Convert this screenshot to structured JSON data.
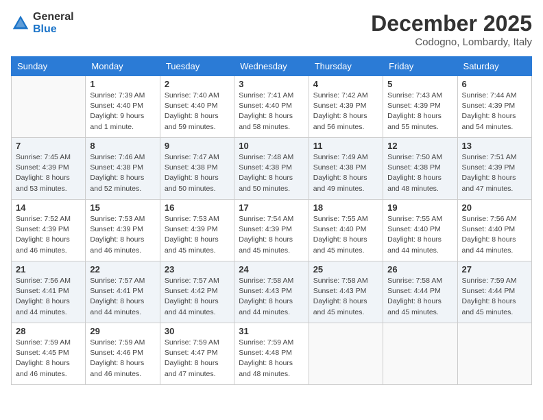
{
  "logo": {
    "general": "General",
    "blue": "Blue"
  },
  "header": {
    "month": "December 2025",
    "location": "Codogno, Lombardy, Italy"
  },
  "weekdays": [
    "Sunday",
    "Monday",
    "Tuesday",
    "Wednesday",
    "Thursday",
    "Friday",
    "Saturday"
  ],
  "weeks": [
    [
      {
        "day": "",
        "info": ""
      },
      {
        "day": "1",
        "info": "Sunrise: 7:39 AM\nSunset: 4:40 PM\nDaylight: 9 hours\nand 1 minute."
      },
      {
        "day": "2",
        "info": "Sunrise: 7:40 AM\nSunset: 4:40 PM\nDaylight: 8 hours\nand 59 minutes."
      },
      {
        "day": "3",
        "info": "Sunrise: 7:41 AM\nSunset: 4:40 PM\nDaylight: 8 hours\nand 58 minutes."
      },
      {
        "day": "4",
        "info": "Sunrise: 7:42 AM\nSunset: 4:39 PM\nDaylight: 8 hours\nand 56 minutes."
      },
      {
        "day": "5",
        "info": "Sunrise: 7:43 AM\nSunset: 4:39 PM\nDaylight: 8 hours\nand 55 minutes."
      },
      {
        "day": "6",
        "info": "Sunrise: 7:44 AM\nSunset: 4:39 PM\nDaylight: 8 hours\nand 54 minutes."
      }
    ],
    [
      {
        "day": "7",
        "info": "Sunrise: 7:45 AM\nSunset: 4:39 PM\nDaylight: 8 hours\nand 53 minutes."
      },
      {
        "day": "8",
        "info": "Sunrise: 7:46 AM\nSunset: 4:38 PM\nDaylight: 8 hours\nand 52 minutes."
      },
      {
        "day": "9",
        "info": "Sunrise: 7:47 AM\nSunset: 4:38 PM\nDaylight: 8 hours\nand 50 minutes."
      },
      {
        "day": "10",
        "info": "Sunrise: 7:48 AM\nSunset: 4:38 PM\nDaylight: 8 hours\nand 50 minutes."
      },
      {
        "day": "11",
        "info": "Sunrise: 7:49 AM\nSunset: 4:38 PM\nDaylight: 8 hours\nand 49 minutes."
      },
      {
        "day": "12",
        "info": "Sunrise: 7:50 AM\nSunset: 4:38 PM\nDaylight: 8 hours\nand 48 minutes."
      },
      {
        "day": "13",
        "info": "Sunrise: 7:51 AM\nSunset: 4:39 PM\nDaylight: 8 hours\nand 47 minutes."
      }
    ],
    [
      {
        "day": "14",
        "info": "Sunrise: 7:52 AM\nSunset: 4:39 PM\nDaylight: 8 hours\nand 46 minutes."
      },
      {
        "day": "15",
        "info": "Sunrise: 7:53 AM\nSunset: 4:39 PM\nDaylight: 8 hours\nand 46 minutes."
      },
      {
        "day": "16",
        "info": "Sunrise: 7:53 AM\nSunset: 4:39 PM\nDaylight: 8 hours\nand 45 minutes."
      },
      {
        "day": "17",
        "info": "Sunrise: 7:54 AM\nSunset: 4:39 PM\nDaylight: 8 hours\nand 45 minutes."
      },
      {
        "day": "18",
        "info": "Sunrise: 7:55 AM\nSunset: 4:40 PM\nDaylight: 8 hours\nand 45 minutes."
      },
      {
        "day": "19",
        "info": "Sunrise: 7:55 AM\nSunset: 4:40 PM\nDaylight: 8 hours\nand 44 minutes."
      },
      {
        "day": "20",
        "info": "Sunrise: 7:56 AM\nSunset: 4:40 PM\nDaylight: 8 hours\nand 44 minutes."
      }
    ],
    [
      {
        "day": "21",
        "info": "Sunrise: 7:56 AM\nSunset: 4:41 PM\nDaylight: 8 hours\nand 44 minutes."
      },
      {
        "day": "22",
        "info": "Sunrise: 7:57 AM\nSunset: 4:41 PM\nDaylight: 8 hours\nand 44 minutes."
      },
      {
        "day": "23",
        "info": "Sunrise: 7:57 AM\nSunset: 4:42 PM\nDaylight: 8 hours\nand 44 minutes."
      },
      {
        "day": "24",
        "info": "Sunrise: 7:58 AM\nSunset: 4:43 PM\nDaylight: 8 hours\nand 44 minutes."
      },
      {
        "day": "25",
        "info": "Sunrise: 7:58 AM\nSunset: 4:43 PM\nDaylight: 8 hours\nand 45 minutes."
      },
      {
        "day": "26",
        "info": "Sunrise: 7:58 AM\nSunset: 4:44 PM\nDaylight: 8 hours\nand 45 minutes."
      },
      {
        "day": "27",
        "info": "Sunrise: 7:59 AM\nSunset: 4:44 PM\nDaylight: 8 hours\nand 45 minutes."
      }
    ],
    [
      {
        "day": "28",
        "info": "Sunrise: 7:59 AM\nSunset: 4:45 PM\nDaylight: 8 hours\nand 46 minutes."
      },
      {
        "day": "29",
        "info": "Sunrise: 7:59 AM\nSunset: 4:46 PM\nDaylight: 8 hours\nand 46 minutes."
      },
      {
        "day": "30",
        "info": "Sunrise: 7:59 AM\nSunset: 4:47 PM\nDaylight: 8 hours\nand 47 minutes."
      },
      {
        "day": "31",
        "info": "Sunrise: 7:59 AM\nSunset: 4:48 PM\nDaylight: 8 hours\nand 48 minutes."
      },
      {
        "day": "",
        "info": ""
      },
      {
        "day": "",
        "info": ""
      },
      {
        "day": "",
        "info": ""
      }
    ]
  ]
}
